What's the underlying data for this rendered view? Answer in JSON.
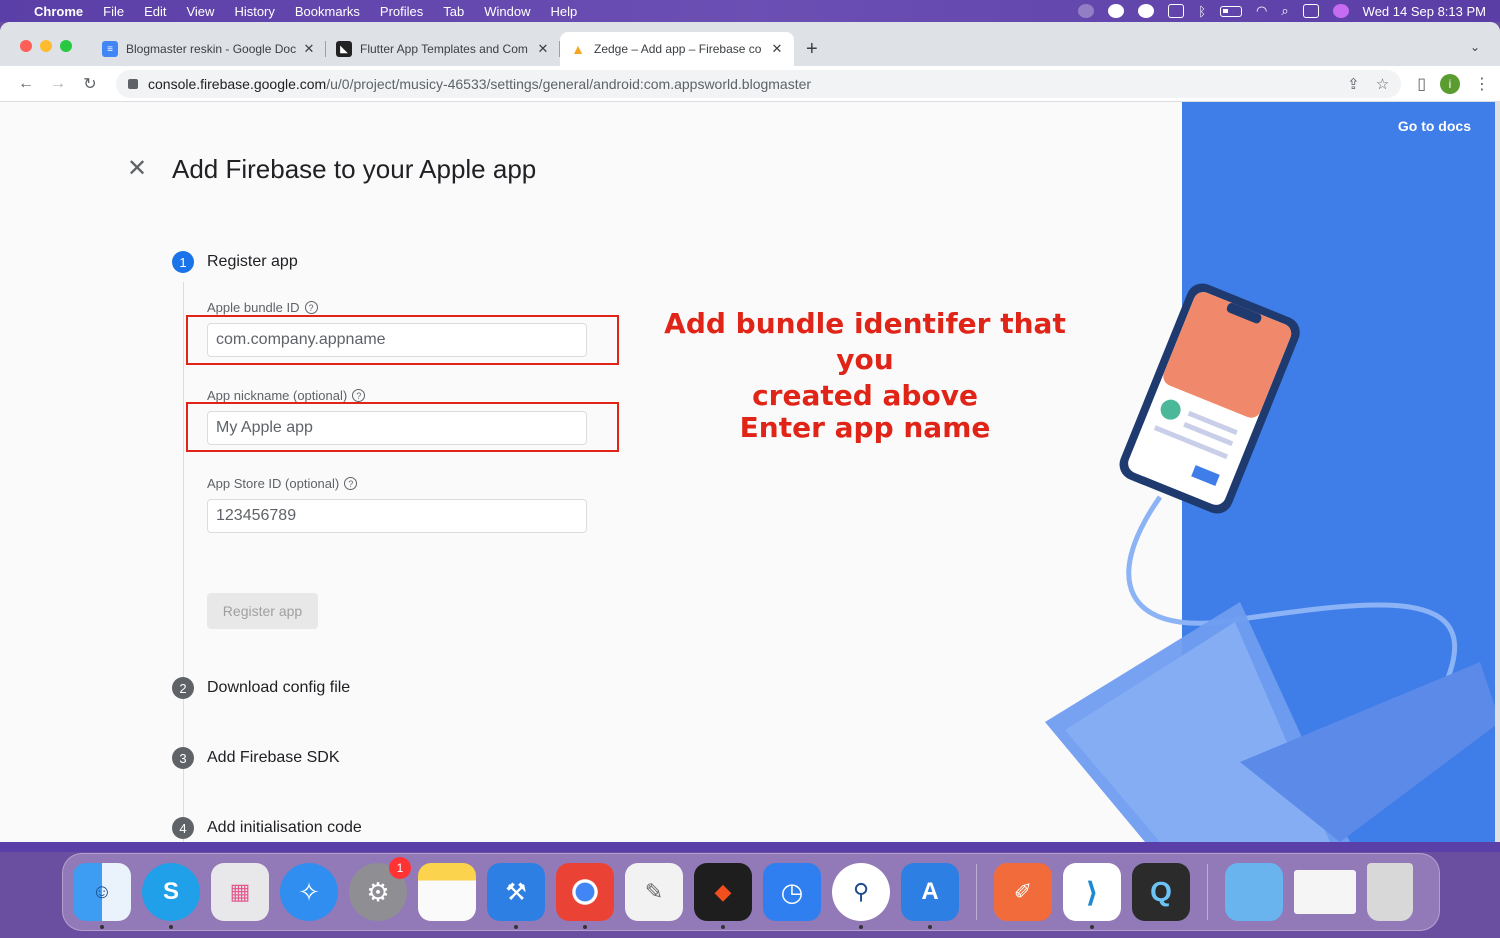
{
  "menubar": {
    "app": "Chrome",
    "items": [
      "File",
      "Edit",
      "View",
      "History",
      "Bookmarks",
      "Profiles",
      "Tab",
      "Window",
      "Help"
    ],
    "clock": "Wed 14 Sep  8:13 PM"
  },
  "tabs": [
    {
      "title": "Blogmaster reskin - Google Docs",
      "icon": "google-docs-icon",
      "active": false
    },
    {
      "title": "Flutter App Templates and Com",
      "icon": "flutter-templates-icon",
      "active": false
    },
    {
      "title": "Zedge – Add app – Firebase co",
      "icon": "firebase-icon",
      "active": true
    }
  ],
  "omnibox": {
    "host": "console.firebase.google.com",
    "path": "/u/0/project/musicy-46533/settings/general/android:com.appsworld.blogmaster"
  },
  "profile_initial": "i",
  "page": {
    "title": "Add Firebase to your Apple app",
    "go_to_docs": "Go to docs",
    "steps": [
      {
        "num": "1",
        "label": "Register app",
        "active": true
      },
      {
        "num": "2",
        "label": "Download config file",
        "active": false
      },
      {
        "num": "3",
        "label": "Add Firebase SDK",
        "active": false
      },
      {
        "num": "4",
        "label": "Add initialisation code",
        "active": false
      }
    ],
    "fields": {
      "bundle_id": {
        "label": "Apple bundle ID",
        "placeholder": "com.company.appname",
        "value": ""
      },
      "nickname": {
        "label": "App nickname (optional)",
        "placeholder": "My Apple app",
        "value": ""
      },
      "appstore_id": {
        "label": "App Store ID (optional)",
        "placeholder": "123456789",
        "value": ""
      }
    },
    "register_button": "Register app"
  },
  "annotations": {
    "bundle": "Add bundle identifer that you created above",
    "bundle_line1": "Add bundle identifer that you",
    "bundle_line2": "created above",
    "name": "Enter app name",
    "color": "#e02417"
  },
  "dock": {
    "apps": [
      {
        "name": "finder-icon",
        "color": "#3d9df3"
      },
      {
        "name": "skype-icon",
        "color": "#1fa0e8",
        "glyph": "S"
      },
      {
        "name": "launchpad-icon",
        "color": "#e8e8ea"
      },
      {
        "name": "safari-icon",
        "color": "#2f8ef0"
      },
      {
        "name": "system-preferences-icon",
        "color": "#8e8e93",
        "badge": "1"
      },
      {
        "name": "notes-icon",
        "color": "#fbd34d"
      },
      {
        "name": "xcode-icon",
        "color": "#2d7fe3"
      },
      {
        "name": "chrome-icon",
        "color": "#ffffff"
      },
      {
        "name": "textedit-icon",
        "color": "#f2f2f2"
      },
      {
        "name": "figma-icon",
        "color": "#1e1e1e"
      },
      {
        "name": "proxyman-icon",
        "color": "#2f7ff0"
      },
      {
        "name": "android-studio-icon",
        "color": "#ffffff"
      },
      {
        "name": "app-store-connect-icon",
        "color": "#2d7fe3"
      },
      {
        "name": "postman-icon",
        "color": "#f26b3a"
      },
      {
        "name": "vscode-icon",
        "color": "#ffffff"
      },
      {
        "name": "quicktime-icon",
        "color": "#2b2b2b"
      },
      {
        "name": "downloads-folder-icon",
        "color": "#69b3ef"
      },
      {
        "name": "skype-window-thumbnail-icon",
        "color": "#f5f5f5"
      },
      {
        "name": "trash-icon",
        "color": "#d8d8d8"
      }
    ]
  }
}
